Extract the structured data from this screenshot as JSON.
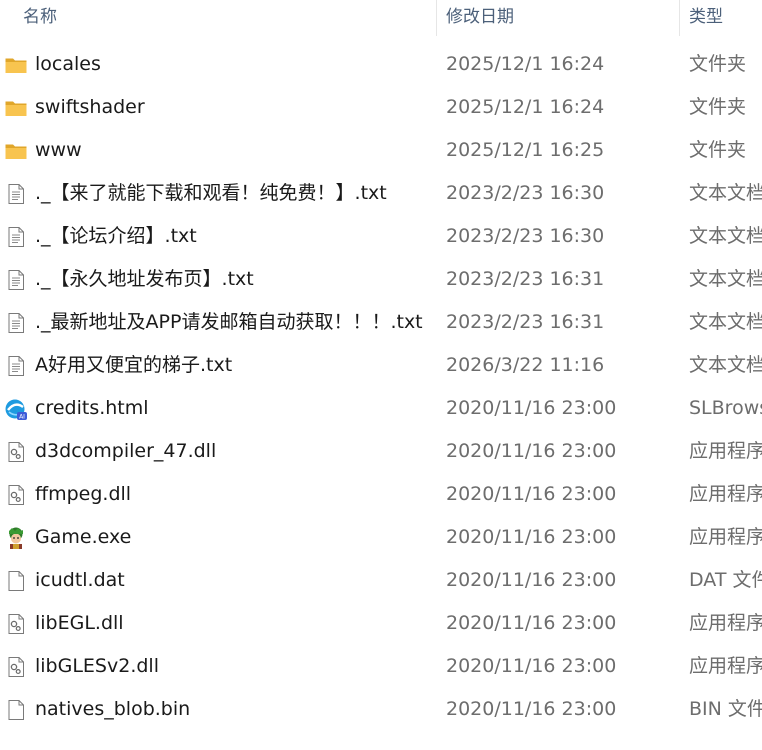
{
  "header": {
    "name_label": "名称",
    "date_label": "修改日期",
    "type_label": "类型",
    "sort_indicator": "^"
  },
  "colors": {
    "header_text": "#4c607a",
    "name_text": "#1a1a1a",
    "secondary_text": "#6d6d6d",
    "folder_yellow": "#f8c44f",
    "folder_dark": "#e0a62a"
  },
  "files": [
    {
      "name": "locales",
      "date": "2025/12/1 16:24",
      "type": "文件夹",
      "icon": "folder"
    },
    {
      "name": "swiftshader",
      "date": "2025/12/1 16:24",
      "type": "文件夹",
      "icon": "folder"
    },
    {
      "name": "www",
      "date": "2025/12/1 16:25",
      "type": "文件夹",
      "icon": "folder"
    },
    {
      "name": "._【来了就能下载和观看！纯免费！】.txt",
      "date": "2023/2/23 16:30",
      "type": "文本文档",
      "icon": "text"
    },
    {
      "name": "._【论坛介绍】.txt",
      "date": "2023/2/23 16:30",
      "type": "文本文档",
      "icon": "text"
    },
    {
      "name": "._【永久地址发布页】.txt",
      "date": "2023/2/23 16:31",
      "type": "文本文档",
      "icon": "text"
    },
    {
      "name": "._最新地址及APP请发邮箱自动获取！！！.txt",
      "date": "2023/2/23 16:31",
      "type": "文本文档",
      "icon": "text"
    },
    {
      "name": "A好用又便宜的梯子.txt",
      "date": "2026/3/22 11:16",
      "type": "文本文档",
      "icon": "text"
    },
    {
      "name": "credits.html",
      "date": "2020/11/16 23:00",
      "type": "SLBrowser",
      "icon": "browser"
    },
    {
      "name": "d3dcompiler_47.dll",
      "date": "2020/11/16 23:00",
      "type": "应用程序扩展",
      "icon": "dll"
    },
    {
      "name": "ffmpeg.dll",
      "date": "2020/11/16 23:00",
      "type": "应用程序扩展",
      "icon": "dll"
    },
    {
      "name": "Game.exe",
      "date": "2020/11/16 23:00",
      "type": "应用程序",
      "icon": "exe"
    },
    {
      "name": "icudtl.dat",
      "date": "2020/11/16 23:00",
      "type": "DAT 文件",
      "icon": "blank"
    },
    {
      "name": "libEGL.dll",
      "date": "2020/11/16 23:00",
      "type": "应用程序扩展",
      "icon": "dll"
    },
    {
      "name": "libGLESv2.dll",
      "date": "2020/11/16 23:00",
      "type": "应用程序扩展",
      "icon": "dll"
    },
    {
      "name": "natives_blob.bin",
      "date": "2020/11/16 23:00",
      "type": "BIN 文件",
      "icon": "blank"
    }
  ]
}
